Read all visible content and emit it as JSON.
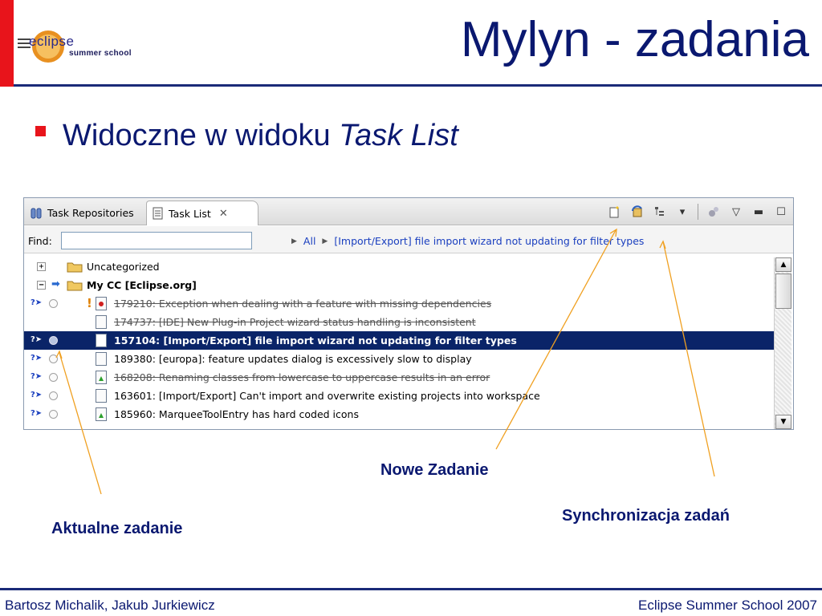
{
  "slide": {
    "title": "Mylyn - zadania",
    "logo_text": "eclipse",
    "logo_sub": "summer school",
    "bullet_prefix": "Widoczne w widoku ",
    "bullet_italic": "Task List"
  },
  "panel": {
    "tabs": [
      {
        "label": "Task Repositories",
        "active": false
      },
      {
        "label": "Task List",
        "active": true
      }
    ],
    "find_label": "Find:",
    "find_value": "",
    "breadcrumb": [
      "All",
      "[Import/Export] file import wizard not updating for filter types"
    ],
    "tree": [
      {
        "type": "category",
        "label": "Uncategorized",
        "expanded": false
      },
      {
        "type": "query",
        "label": "My CC  [Eclipse.org]",
        "expanded": true
      },
      {
        "type": "task",
        "label": "179210: Exception when dealing with a feature with missing dependencies",
        "completed": true,
        "priority": true,
        "icon": "red"
      },
      {
        "type": "task",
        "label": "174737: [IDE] New Plug-in Project wizard status handling is inconsistent",
        "completed": true,
        "priority": false,
        "icon": "plain"
      },
      {
        "type": "task",
        "label": "157104: [Import/Export] file import wizard not updating for filter types",
        "completed": false,
        "selected": true,
        "icon": "plain"
      },
      {
        "type": "task",
        "label": "189380: [europa]: feature updates dialog is excessively slow to display",
        "completed": false,
        "icon": "plain"
      },
      {
        "type": "task",
        "label": "168208: Renaming classes from lowercase to uppercase results in an error",
        "completed": true,
        "icon": "green"
      },
      {
        "type": "task",
        "label": "163601: [Import/Export] Can't import and overwrite existing projects into workspace",
        "completed": false,
        "icon": "plain"
      },
      {
        "type": "task",
        "label": "185960: MarqueeToolEntry has hard coded icons",
        "completed": false,
        "icon": "green"
      }
    ]
  },
  "callouts": {
    "new_task": "Nowe Zadanie",
    "sync": "Synchronizacja zadań",
    "current": "Aktualne zadanie"
  },
  "footer": {
    "left": "Bartosz Michalik, Jakub Jurkiewicz",
    "right": "Eclipse Summer School 2007"
  },
  "colors": {
    "title": "#0a1870",
    "accent_red": "#e8141b",
    "selection": "#0a2468",
    "callout_line": "#f0a020"
  }
}
